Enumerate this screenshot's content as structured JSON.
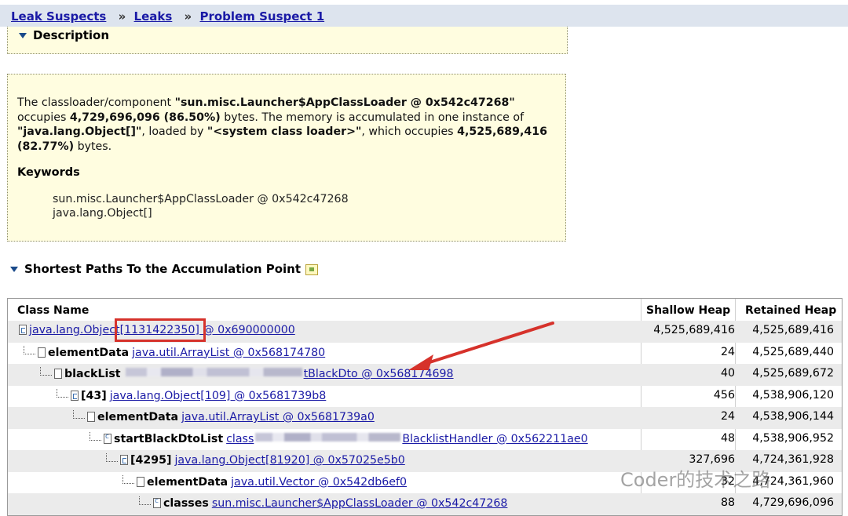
{
  "breadcrumb": {
    "items": [
      "Leak Suspects",
      "Leaks",
      "Problem Suspect 1"
    ],
    "separator": "»"
  },
  "description": {
    "heading": "Description"
  },
  "suspect": {
    "p1": "The classloader/component ",
    "p2": "\"sun.misc.Launcher$AppClassLoader @ 0x542c47268\"",
    "p3": " occupies ",
    "p4": "4,729,696,096 (86.50%)",
    "p5": " bytes. The memory is accumulated in one instance of ",
    "p6": "\"java.lang.Object[]\"",
    "p7": ", loaded by ",
    "p8": "\"<system class loader>\"",
    "p9": ", which occupies ",
    "p10": "4,525,689,416 (82.77%)",
    "p11": " bytes.",
    "keywords_title": "Keywords",
    "keywords": [
      "sun.misc.Launcher$AppClassLoader @ 0x542c47268",
      "java.lang.Object[]"
    ]
  },
  "paths": {
    "heading": "Shortest Paths To the Accumulation Point",
    "columns": [
      "Class Name",
      "Shallow Heap",
      "Retained Heap"
    ],
    "rows": [
      {
        "label": "",
        "link": "java.lang.Object[1131422350] @ 0x690000000",
        "shallow": "4,525,689,416",
        "retained": "4,525,689,416"
      },
      {
        "label": "elementData",
        "link": "java.util.ArrayList @ 0x568174780",
        "shallow": "24",
        "retained": "4,525,689,440"
      },
      {
        "label": "blackList",
        "link": "tBlackDto @ 0x568174698",
        "shallow": "40",
        "retained": "4,525,689,672"
      },
      {
        "label": "[43]",
        "link": "java.lang.Object[109] @ 0x5681739b8",
        "shallow": "456",
        "retained": "4,538,906,120"
      },
      {
        "label": "elementData",
        "link": "java.util.ArrayList @ 0x5681739a0",
        "shallow": "24",
        "retained": "4,538,906,144"
      },
      {
        "label": "startBlackDtoList",
        "link_prefix": "class",
        "link": "BlacklistHandler @ 0x562211ae0",
        "shallow": "48",
        "retained": "4,538,906,952"
      },
      {
        "label": "[4295]",
        "link": "java.lang.Object[81920] @ 0x57025e5b0",
        "shallow": "327,696",
        "retained": "4,724,361,928"
      },
      {
        "label": "elementData",
        "link": "java.util.Vector @ 0x542db6ef0",
        "shallow": "32",
        "retained": "4,724,361,960"
      },
      {
        "label": "classes",
        "link": "sun.misc.Launcher$AppClassLoader @ 0x542c47268",
        "shallow": "88",
        "retained": "4,729,696,096"
      }
    ]
  },
  "watermark": "Coder的技术之路",
  "colors": {
    "link": "#1a1aa6",
    "highlight": "#d6322b",
    "panel": "#fffde0"
  }
}
